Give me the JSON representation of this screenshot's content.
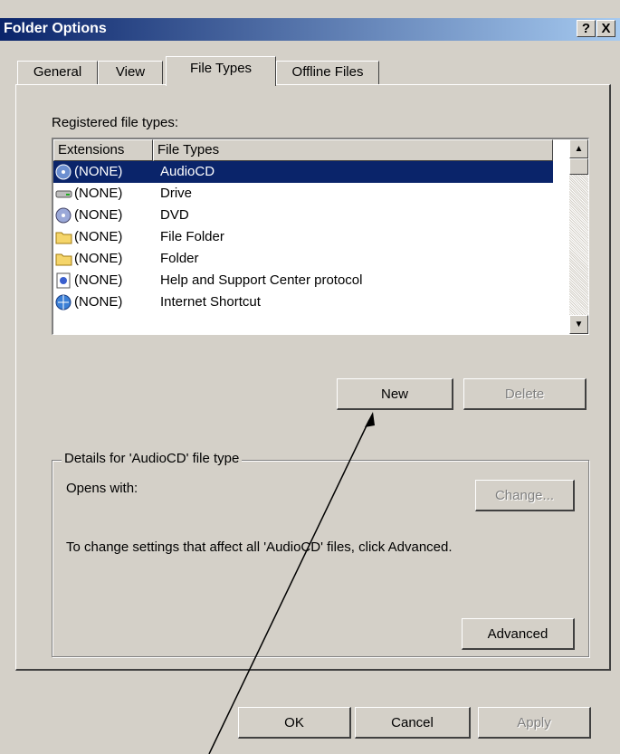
{
  "window": {
    "title": "Folder Options",
    "help_btn": "?",
    "close_btn": "X"
  },
  "tabs": [
    {
      "label": "General"
    },
    {
      "label": "View"
    },
    {
      "label": "File Types",
      "active": true
    },
    {
      "label": "Offline Files"
    }
  ],
  "registered_label": "Registered file types:",
  "list": {
    "columns": [
      "Extensions",
      "File Types"
    ],
    "rows": [
      {
        "ext": "(NONE)",
        "type": "AudioCD",
        "icon": "audiocd-icon",
        "selected": true
      },
      {
        "ext": "(NONE)",
        "type": "Drive",
        "icon": "drive-icon"
      },
      {
        "ext": "(NONE)",
        "type": "DVD",
        "icon": "dvd-icon"
      },
      {
        "ext": "(NONE)",
        "type": "File Folder",
        "icon": "folder-icon"
      },
      {
        "ext": "(NONE)",
        "type": "Folder",
        "icon": "folder-icon"
      },
      {
        "ext": "(NONE)",
        "type": "Help and Support Center protocol",
        "icon": "help-icon"
      },
      {
        "ext": "(NONE)",
        "type": "Internet Shortcut",
        "icon": "internet-icon"
      }
    ]
  },
  "buttons": {
    "new": "New",
    "delete": "Delete",
    "change": "Change...",
    "advanced": "Advanced",
    "ok": "OK",
    "cancel": "Cancel",
    "apply": "Apply"
  },
  "details": {
    "group_title": "Details for 'AudioCD' file type",
    "opens_with": "Opens with:",
    "info": "To change settings that affect all 'AudioCD' files, click Advanced."
  },
  "colors": {
    "title_bar": "#0a246a",
    "selection": "#0a246a",
    "face": "#d4d0c8"
  }
}
